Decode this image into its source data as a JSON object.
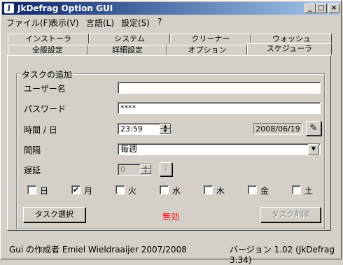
{
  "window": {
    "title": "JkDefrag Option GUI",
    "minimize": "_",
    "maximize": "□",
    "close": "×"
  },
  "menu": [
    "ファイル(F)",
    "表示(V)",
    "言語(L)",
    "設定(S)",
    "?"
  ],
  "tabs_top": [
    "インストーラ",
    "システム",
    "クリーナー",
    "ウォッシュ"
  ],
  "tabs_bottom": [
    "全般設定",
    "詳細設定",
    "オプション",
    "スケジューラ"
  ],
  "group": {
    "title": "タスクの追加",
    "username_label": "ユーザー名",
    "username_value": "",
    "password_label": "パスワード",
    "password_value": "****",
    "time_label": "時間 / 日",
    "time_value": "23:59",
    "date_value": "2008/06/19",
    "interval_label": "間隔",
    "interval_value": "毎週",
    "delay_label": "遅延",
    "delay_value": "0",
    "help_button": "?",
    "days": [
      {
        "label": "日",
        "checked": false
      },
      {
        "label": "月",
        "checked": true
      },
      {
        "label": "火",
        "checked": false
      },
      {
        "label": "水",
        "checked": false
      },
      {
        "label": "木",
        "checked": false
      },
      {
        "label": "金",
        "checked": false
      },
      {
        "label": "土",
        "checked": false
      }
    ],
    "select_task_button": "タスク選択",
    "status_text": "無効",
    "status_color": "#ff0000",
    "delete_task_button": "タスク削除"
  },
  "footer": {
    "author": "Gui の作成者 Emiel Wieldraaijer 2007/2008",
    "version": "バージョン 1.02 (JkDefrag 3.34)"
  }
}
